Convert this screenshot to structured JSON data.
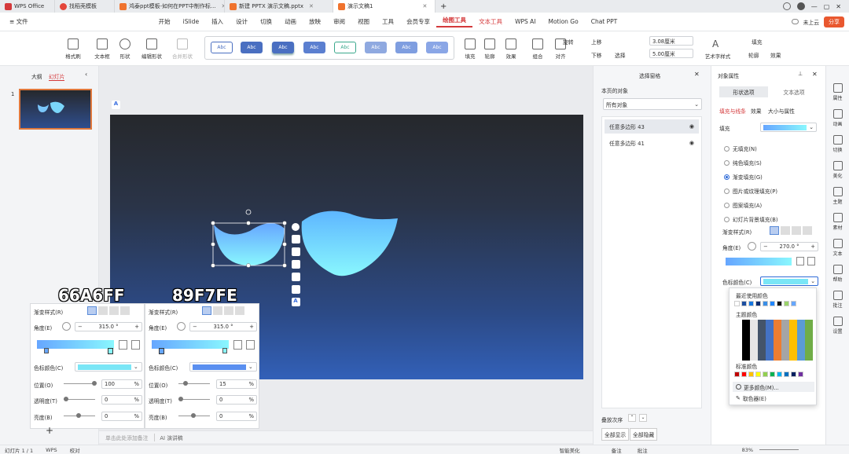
{
  "tabs": [
    {
      "label": "WPS Office",
      "color": "#d4393b"
    },
    {
      "label": "找稻壳模板",
      "color": "#e4463a"
    },
    {
      "label": "鸿泰ppt模板-如何在PPT中制作标...",
      "color": "#f0732e"
    },
    {
      "label": "新建 PPTX 演示文稿.pptx",
      "color": "#f0732e"
    },
    {
      "label": "演示文稿1",
      "color": "#f0732e"
    }
  ],
  "window_right": {
    "cloud": "未上云",
    "share": "分享"
  },
  "menus": [
    "≡ 文件",
    "开始",
    "iSlide",
    "插入",
    "设计",
    "切换",
    "动画",
    "放映",
    "审阅",
    "视图",
    "工具",
    "会员专享",
    "绘图工具",
    "文本工具",
    "WPS AI",
    "Motion Go",
    "Chat PPT"
  ],
  "toolbar": {
    "format_painter": "格式刷",
    "textbox": "文本框",
    "shape": "形状",
    "edit_shape": "编辑形状",
    "merge_shape": "合并形状",
    "styles": [
      "Abc",
      "Abc",
      "Abc",
      "Abc",
      "Abc",
      "Abc",
      "Abc",
      "Abc"
    ],
    "fill": "填充",
    "outline": "轮廓",
    "effect": "效果",
    "combine": "组合",
    "align": "对齐",
    "rotate": "旋转",
    "up": "上移",
    "down": "下移",
    "select": "选择",
    "height": "3.08厘米",
    "width": "5.00厘米",
    "art_text": "艺术字样式",
    "fill2": "填充",
    "outline2": "轮廓",
    "effect2": "效果"
  },
  "left_panel": {
    "outline_tab": "大纲",
    "slides_tab": "幻灯片",
    "slide_number": "1"
  },
  "selection_pane": {
    "title": "选择窗格",
    "subtitle": "本页的对象",
    "filter": "所有对象",
    "items": [
      "任意多边形 43",
      "任意多边形 41"
    ],
    "order_label": "叠放次序",
    "show_all": "全部显示",
    "hide_all": "全部隐藏"
  },
  "object_props": {
    "title": "对象属性",
    "tab_shape": "形状选项",
    "tab_text": "文本选项",
    "subtabs": [
      "填充与线条",
      "效果",
      "大小与属性"
    ],
    "fill_section": "填充",
    "fill_options": [
      "无填充(N)",
      "纯色填充(S)",
      "渐变填充(G)",
      "图片或纹理填充(P)",
      "图案填充(A)",
      "幻灯片背景填充(B)"
    ],
    "fill_selected": 2,
    "gradient_style": "渐变样式(R)",
    "angle_label": "角度(E)",
    "angle_value": "270.0 °",
    "stop_color": "色标颜色(C)",
    "stop_color_value": "#7ae6f6"
  },
  "color_picker": {
    "recent": "最近使用颜色",
    "theme": "主题颜色",
    "standard": "标准颜色",
    "more": "更多颜色(M)...",
    "eyedropper": "取色器(E)",
    "recent_colors": [
      "#ffffff",
      "#1d4fa0",
      "#1677e0",
      "#0d2b6e",
      "#3a8ee6",
      "#1f86ff",
      "#121212",
      "#9ad36a",
      "#66a6ff"
    ],
    "standard_colors": [
      "#c00000",
      "#ff0000",
      "#ffc000",
      "#ffff00",
      "#92d050",
      "#00b050",
      "#00b0f0",
      "#0070c0",
      "#002060",
      "#7030a0"
    ]
  },
  "annotations": {
    "left_color": "66A6FF",
    "right_color": "89F7FE"
  },
  "overlay_left": {
    "gradient_style": "渐变样式(R)",
    "angle_label": "角度(E)",
    "angle_value": "315.0 °",
    "stop_color": "色标颜色(C)",
    "stop_color_value": "#7ae6f6",
    "position_label": "位置(O)",
    "position_value": "100",
    "transparency_label": "透明度(T)",
    "transparency_value": "0",
    "brightness_label": "亮度(B)",
    "brightness_value": "0",
    "unit": "%"
  },
  "overlay_right": {
    "gradient_style": "渐变样式(R)",
    "angle_label": "角度(E)",
    "angle_value": "315.0 °",
    "stop_color": "色标颜色(C)",
    "stop_color_value": "#5a8ff0",
    "position_label": "位置(O)",
    "position_value": "15",
    "transparency_label": "透明度(T)",
    "transparency_value": "0",
    "brightness_label": "亮度(B)",
    "brightness_value": "0",
    "unit": "%"
  },
  "notes": {
    "placeholder": "单击此处添加备注",
    "ai": "AI 演讲稿"
  },
  "right_sidebar": [
    "属性",
    "动画",
    "切换",
    "美化",
    "主题",
    "素材",
    "文本",
    "帮助",
    "批注",
    "设置"
  ],
  "status": {
    "slide": "幻灯片 1 / 1",
    "wps": "WPS",
    "proof": "校对",
    "beautify": "智能美化",
    "notes": "备注",
    "comments": "批注",
    "zoom": "83%"
  }
}
